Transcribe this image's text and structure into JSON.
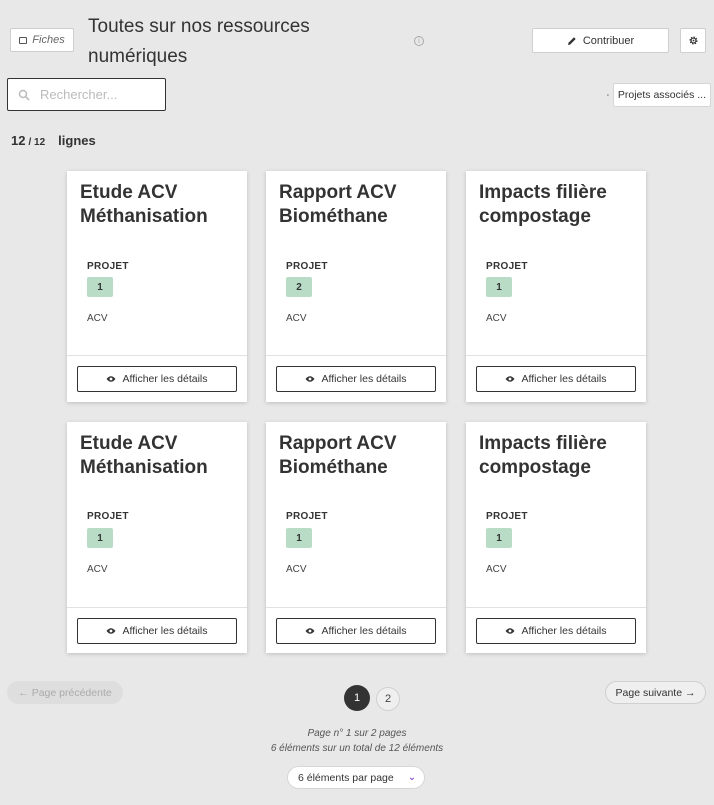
{
  "header": {
    "fiches_label": "Fiches",
    "title": "Toutes sur nos ressources numériques",
    "contribute_label": "Contribuer"
  },
  "search": {
    "placeholder": "Rechercher..."
  },
  "filter": {
    "label": "Projets associés ..."
  },
  "counts": {
    "shown": "12",
    "total": "/ 12",
    "unit": "lignes"
  },
  "cards": [
    {
      "title": "Etude ACV Méthanisation",
      "meta_label": "PROJET",
      "badge": "1",
      "tag": "ACV",
      "button": "Afficher les détails"
    },
    {
      "title": "Rapport ACV Biométhane",
      "meta_label": "PROJET",
      "badge": "2",
      "tag": "ACV",
      "button": "Afficher les détails"
    },
    {
      "title": "Impacts filière compostage",
      "meta_label": "PROJET",
      "badge": "1",
      "tag": "ACV",
      "button": "Afficher les détails"
    },
    {
      "title": "Etude ACV Méthanisation",
      "meta_label": "PROJET",
      "badge": "1",
      "tag": "ACV",
      "button": "Afficher les détails"
    },
    {
      "title": "Rapport ACV Biométhane",
      "meta_label": "PROJET",
      "badge": "1",
      "tag": "ACV",
      "button": "Afficher les détails"
    },
    {
      "title": "Impacts filière compostage",
      "meta_label": "PROJET",
      "badge": "1",
      "tag": "ACV",
      "button": "Afficher les détails"
    }
  ],
  "pagination": {
    "prev_label": "← Page précédente",
    "next_label": "Page suivante →",
    "pages": [
      "1",
      "2"
    ],
    "current_page": "1",
    "info_line1": "Page n° 1 sur 2 pages",
    "info_line2": "6 éléments sur un total de 12 éléments",
    "per_page_label": "6 éléments par page"
  },
  "colors": {
    "background": "#e8e8e8",
    "badge": "#b9dcc7",
    "active_page": "#333333",
    "dropdown_accent": "#6a2cc4"
  }
}
